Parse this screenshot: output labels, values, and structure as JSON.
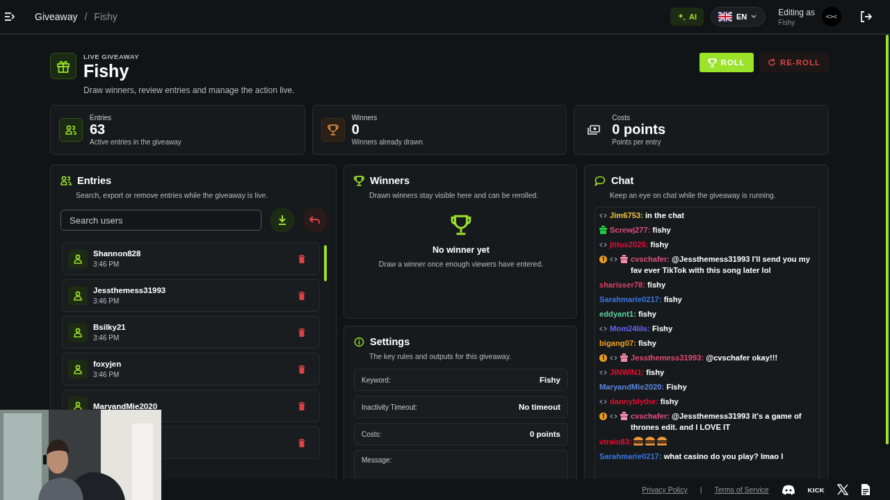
{
  "topbar": {
    "breadcrumb": [
      "Giveaway",
      "/",
      "Fishy"
    ],
    "ai_button": "AI",
    "language": "EN",
    "editing_label": "Editing as",
    "editing_user": "Fishy",
    "avatar_text": "<><"
  },
  "header": {
    "eyebrow": "LIVE GIVEAWAY",
    "title": "Fishy",
    "subtitle": "Draw winners, review entries and manage the action live.",
    "buttons": [
      {
        "label": "ROLL",
        "kind": "primary"
      },
      {
        "label": "RE-ROLL",
        "kind": "danger"
      }
    ]
  },
  "stats": [
    {
      "kind": "users",
      "label": "Entries",
      "value": "63",
      "note": "Active entries in the giveaway"
    },
    {
      "kind": "trophy",
      "label": "Winners",
      "value": "0",
      "note": "Winners already drawn"
    },
    {
      "kind": "cash",
      "label": "Costs",
      "value": "0 points",
      "note": "Points per entry"
    }
  ],
  "entries": {
    "title": "Entries",
    "subtitle": "Search, export or remove entries while the giveaway is live.",
    "search": {
      "placeholder": "Search users"
    },
    "items": [
      {
        "name": "Shannon828",
        "time": "3:46 PM"
      },
      {
        "name": "Jessthemess31993",
        "time": "3:46 PM"
      },
      {
        "name": "Bsilky21",
        "time": "3:46 PM"
      },
      {
        "name": "foxyjen",
        "time": "3:46 PM"
      },
      {
        "name": "MaryandMie2020"
      }
    ]
  },
  "winners": {
    "title": "Winners",
    "subtitle": "Drawn winners stay visible here and can be rerolled.",
    "empty_title": "No winner yet",
    "empty_text": "Draw a winner once enough viewers have entered."
  },
  "settings": {
    "title": "Settings",
    "subtitle": "The key rules and outputs for this giveaway.",
    "rows": [
      {
        "label": "Keyword:",
        "value": "Fishy"
      },
      {
        "label": "Inactivity Timeout:",
        "value": "No timeout"
      },
      {
        "label": "Costs:",
        "value": "0 points"
      },
      {
        "label": "Message:"
      }
    ]
  },
  "chat": {
    "title": "Chat",
    "subtitle": "Keep an eye on chat while the giveaway is running.",
    "messages": [
      {
        "badges": [
          {
            "kind": "mod"
          }
        ],
        "user": "Jim6753:",
        "color": "#f0c040",
        "text": "in the chat"
      },
      {
        "badges": [
          {
            "kind": "sub"
          }
        ],
        "user": "Screwj277:",
        "color": "#e04a7a",
        "text": "fishy"
      },
      {
        "badges": [
          {
            "kind": "mod"
          }
        ],
        "user": "jtitus2025:",
        "color": "#e0103c",
        "text": "fishy"
      },
      {
        "badges": [
          {
            "kind": "one"
          },
          {
            "kind": "mod"
          },
          {
            "kind": "gift"
          }
        ],
        "user": "cvschafer:",
        "color": "#e0507e",
        "text": "@Jessthemess31993 I'll send you my fav ever TikTok with this song later lol"
      },
      {
        "user": "sharisser78:",
        "color": "#e0406a",
        "text": "fishy"
      },
      {
        "user": "Sarahmarie0217:",
        "color": "#3a76e0",
        "text": "fishy"
      },
      {
        "user": "eddyant1:",
        "color": "#60d0a0",
        "text": "fishy"
      },
      {
        "badges": [
          {
            "kind": "mod"
          }
        ],
        "user": "Mom24lils:",
        "color": "#6464f0",
        "text": "Fishy"
      },
      {
        "user": "bigang07:",
        "color": "#f0a020",
        "text": "fishy"
      },
      {
        "badges": [
          {
            "kind": "one"
          },
          {
            "kind": "mod"
          },
          {
            "kind": "gift"
          }
        ],
        "user": "Jessthemess31993:",
        "color": "#e04a74",
        "text": "@cvschafer okay!!!"
      },
      {
        "badges": [
          {
            "kind": "mod"
          }
        ],
        "user": "JINWIN1:",
        "color": "#e01030",
        "text": "fishy"
      },
      {
        "user": "MaryandMie2020:",
        "color": "#5a86e0",
        "text": "Fishy"
      },
      {
        "badges": [
          {
            "kind": "mod"
          }
        ],
        "user": "dannyblythe:",
        "color": "#e01030",
        "text": "fishy"
      },
      {
        "badges": [
          {
            "kind": "one"
          },
          {
            "kind": "mod"
          },
          {
            "kind": "gift"
          }
        ],
        "user": "cvschafer:",
        "color": "#e0507e",
        "text": "@Jessthemess31993 it's a game of thrones edit. and I LOVE IT"
      },
      {
        "user": "vtrain83:",
        "color": "#e01030",
        "emotes": [
          {
            "kind": "burger"
          },
          {
            "kind": "burger"
          },
          {
            "kind": "burger"
          }
        ]
      },
      {
        "user": "Sarahmarie0217:",
        "color": "#3a76e0",
        "text": "what casino do you play? lmao I"
      }
    ]
  },
  "footer": {
    "links": [
      "Privacy Policy",
      "|",
      "Terms of Service"
    ],
    "kick_label": "KICK"
  }
}
